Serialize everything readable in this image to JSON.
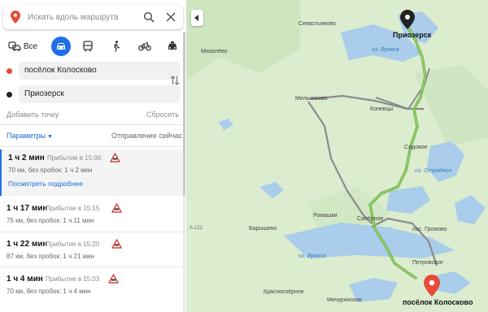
{
  "search": {
    "placeholder": "Искать вдоль маршрута"
  },
  "transport_modes": {
    "all_label": "Все"
  },
  "route_points": {
    "from": "посёлок Колосково",
    "to": "Приозерск",
    "add_point": "Добавить точку",
    "reset": "Сбросить"
  },
  "options": {
    "params_label": "Параметры",
    "departure": "Отправление сейчас"
  },
  "routes": [
    {
      "duration": "1 ч 2 мин",
      "arrival": "Прибытие в 15:00",
      "details": "70 км, без пробок: 1 ч 2 мин",
      "more": "Посмотреть подробнее"
    },
    {
      "duration": "1 ч 17 мин",
      "arrival": "Прибытие в 15:15",
      "details": "75 км, без пробок: 1 ч 11 мин"
    },
    {
      "duration": "1 ч 22 мин",
      "arrival": "Прибытие в 15:20",
      "details": "87 км, без пробок: 1 ч 21 мин"
    },
    {
      "duration": "1 ч 4 мин",
      "arrival": "Прибытие в 15:03",
      "details": "70 км, без пробок: 1 ч 4 мин"
    }
  ],
  "colors": {
    "accent": "#1e6fe8",
    "start_marker": "#e84a3a",
    "route_active": "#7fbf3f",
    "route_alt": "#8c8c8c",
    "water": "#a9cdea",
    "land": "#dbeccf"
  },
  "map": {
    "places": {
      "sevastyanovo": "Севастьяново",
      "mikhalevo": "Михалёво",
      "priozersk": "Приозерск",
      "vuoksa_north": "оз. Вуокса",
      "melnikovo": "Мельниково",
      "konevcy": "Коневцы",
      "sadovoe": "Садовое",
      "otradnoe": "оз. Отрадное",
      "romashki": "Ромашки",
      "sapernoe": "Сапёрное",
      "gromovo": "пос. Громово",
      "baryshevo": "Барышево",
      "vuoksa_south": "оз. Вуокса",
      "petrovskoe": "Петровское",
      "krasnoozernoe": "Красноозёрное",
      "michurinskoe": "Мичуринское",
      "koloskovo": "посёлок Колосково",
      "road_a121": "А-121"
    }
  }
}
